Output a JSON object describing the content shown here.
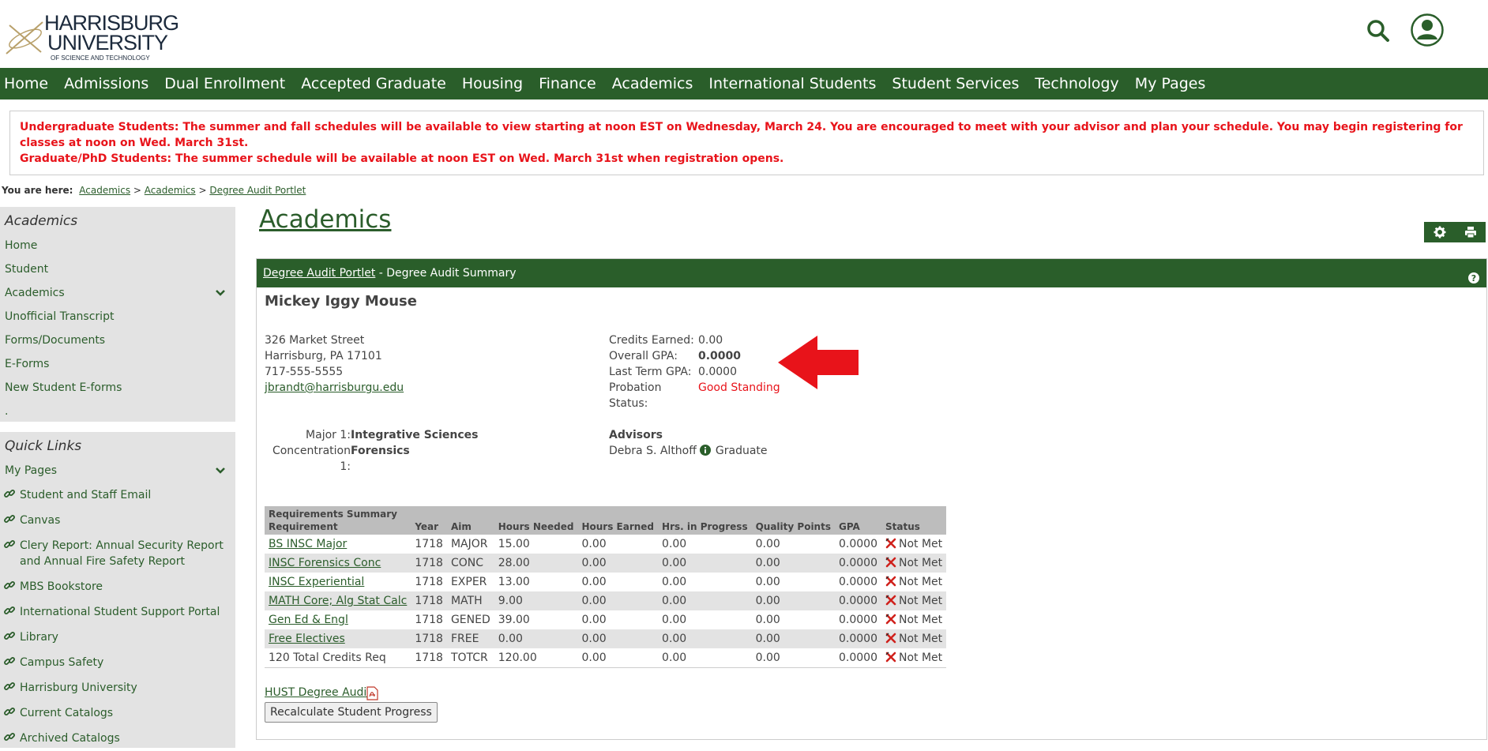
{
  "logo": {
    "line1": "HARRISBURG",
    "line2": "UNIVERSITY",
    "line3": "OF SCIENCE AND TECHNOLOGY"
  },
  "nav": [
    "Home",
    "Admissions",
    "Dual Enrollment",
    "Accepted Graduate",
    "Housing",
    "Finance",
    "Academics",
    "International Students",
    "Student Services",
    "Technology",
    "My Pages"
  ],
  "alert": {
    "line1": "Undergraduate Students: The summer and fall schedules will be available to view starting at noon EST on Wednesday, March 24.  You are encouraged to meet with your advisor and plan your schedule.  You may begin registering for classes at noon on Wed. March 31st.",
    "line2": "Graduate/PhD Students: The summer schedule will be available at noon EST on Wed. March 31st when registration opens."
  },
  "breadcrumb": {
    "label": "You are here:",
    "items": [
      "Academics",
      "Academics",
      "Degree Audit Portlet"
    ],
    "sep": ">"
  },
  "sidebar": {
    "title": "Academics",
    "items": [
      "Home",
      "Student",
      "Academics",
      "Unofficial Transcript",
      "Forms/Documents",
      "E-Forms",
      "New Student E-forms",
      "."
    ]
  },
  "quicklinks": {
    "title": "Quick Links",
    "mypages": "My Pages",
    "items": [
      "Student and Staff Email",
      "Canvas",
      "Clery Report: Annual Security Report and Annual Fire Safety Report",
      "MBS Bookstore",
      "International Student Support Portal",
      "Library",
      "Campus Safety",
      "Harrisburg University",
      "Current Catalogs",
      "Archived Catalogs"
    ]
  },
  "page_title": "Academics",
  "portlet": {
    "link": "Degree Audit Portlet",
    "suffix": " - Degree Audit Summary"
  },
  "student": {
    "name": "Mickey Iggy Mouse",
    "address1": "326 Market Street",
    "address2": "Harrisburg, PA 17101",
    "phone": "717-555-5555",
    "email": "jbrandt@harrisburgu.edu"
  },
  "stats": {
    "credits_label": "Credits Earned:",
    "credits": "0.00",
    "gpa_label": "Overall GPA:",
    "gpa": "0.0000",
    "last_label": "Last Term GPA:",
    "last": "0.0000",
    "probation_label": "Probation Status:",
    "probation": "Good Standing"
  },
  "program": {
    "major_label": "Major 1:",
    "major": "Integrative Sciences",
    "conc_label": "Concentration 1:",
    "conc": "Forensics"
  },
  "advisors": {
    "title": "Advisors",
    "name": "Debra S. Althoff",
    "role": "Graduate"
  },
  "requirements": {
    "caption": "Requirements Summary",
    "headers": [
      "Requirement",
      "Year",
      "Aim",
      "Hours Needed",
      "Hours Earned",
      "Hrs. in Progress",
      "Quality Points",
      "GPA",
      "Status"
    ],
    "rows": [
      [
        "BS INSC Major",
        "1718",
        "MAJOR",
        "15.00",
        "0.00",
        "0.00",
        "0.00",
        "0.0000",
        "Not Met"
      ],
      [
        "INSC Forensics Conc",
        "1718",
        "CONC",
        "28.00",
        "0.00",
        "0.00",
        "0.00",
        "0.0000",
        "Not Met"
      ],
      [
        "INSC Experiential",
        "1718",
        "EXPER",
        "13.00",
        "0.00",
        "0.00",
        "0.00",
        "0.0000",
        "Not Met"
      ],
      [
        "MATH Core; Alg Stat Calc",
        "1718",
        "MATH",
        "9.00",
        "0.00",
        "0.00",
        "0.00",
        "0.0000",
        "Not Met"
      ],
      [
        "Gen Ed & Engl",
        "1718",
        "GENED",
        "39.00",
        "0.00",
        "0.00",
        "0.00",
        "0.0000",
        "Not Met"
      ],
      [
        "Free Electives",
        "1718",
        "FREE",
        "0.00",
        "0.00",
        "0.00",
        "0.00",
        "0.0000",
        "Not Met"
      ],
      [
        "120 Total Credits Req",
        "1718",
        "TOTCR",
        "120.00",
        "0.00",
        "0.00",
        "0.00",
        "0.0000",
        "Not Met"
      ]
    ]
  },
  "audit_link": "HUST Degree Audit",
  "recalc_label": "Recalculate Student Progress",
  "colors": {
    "brand_green": "#2a5e2a",
    "alert_red": "#e8131a",
    "link_green": "#2b5d2b"
  }
}
